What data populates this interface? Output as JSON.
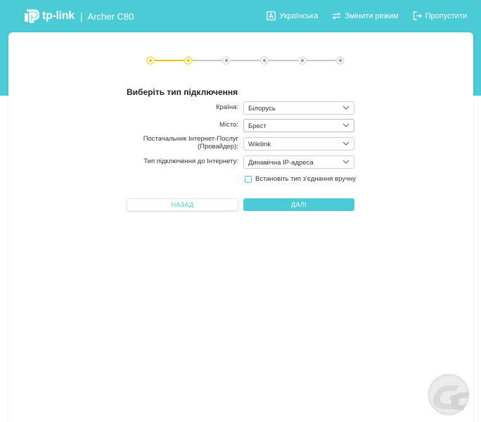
{
  "header": {
    "brand": "tp-link",
    "separator": "|",
    "model": "Archer C80",
    "actions": [
      {
        "label": "Українська",
        "icon": "language-icon"
      },
      {
        "label": "Змінити режим",
        "icon": "switch-mode-icon"
      },
      {
        "label": "Пропустити",
        "icon": "skip-icon"
      }
    ]
  },
  "stepper": {
    "total_steps": 6,
    "current_step": 2
  },
  "form": {
    "title": "Виберіть тип підключення",
    "fields": [
      {
        "label": "Країна:",
        "value": "Білорусь"
      },
      {
        "label": "Місто:",
        "value": "Брест"
      },
      {
        "label_line1": "Постачальник Інтернет-Послуг",
        "label_line2": "(Провайдер):",
        "value": "Wikilink"
      },
      {
        "label": "Тип підключення до Інтернету:",
        "value": "Динамічна IP-адреса"
      }
    ],
    "manual_checkbox": {
      "label": "Встановіть тип з'єднання вручну",
      "checked": false
    }
  },
  "buttons": {
    "back": "НАЗАД",
    "next": "ДАЛІ"
  },
  "colors": {
    "accent": "#4acbd6",
    "step_active": "#f2c20f",
    "step_inactive": "#999999"
  }
}
